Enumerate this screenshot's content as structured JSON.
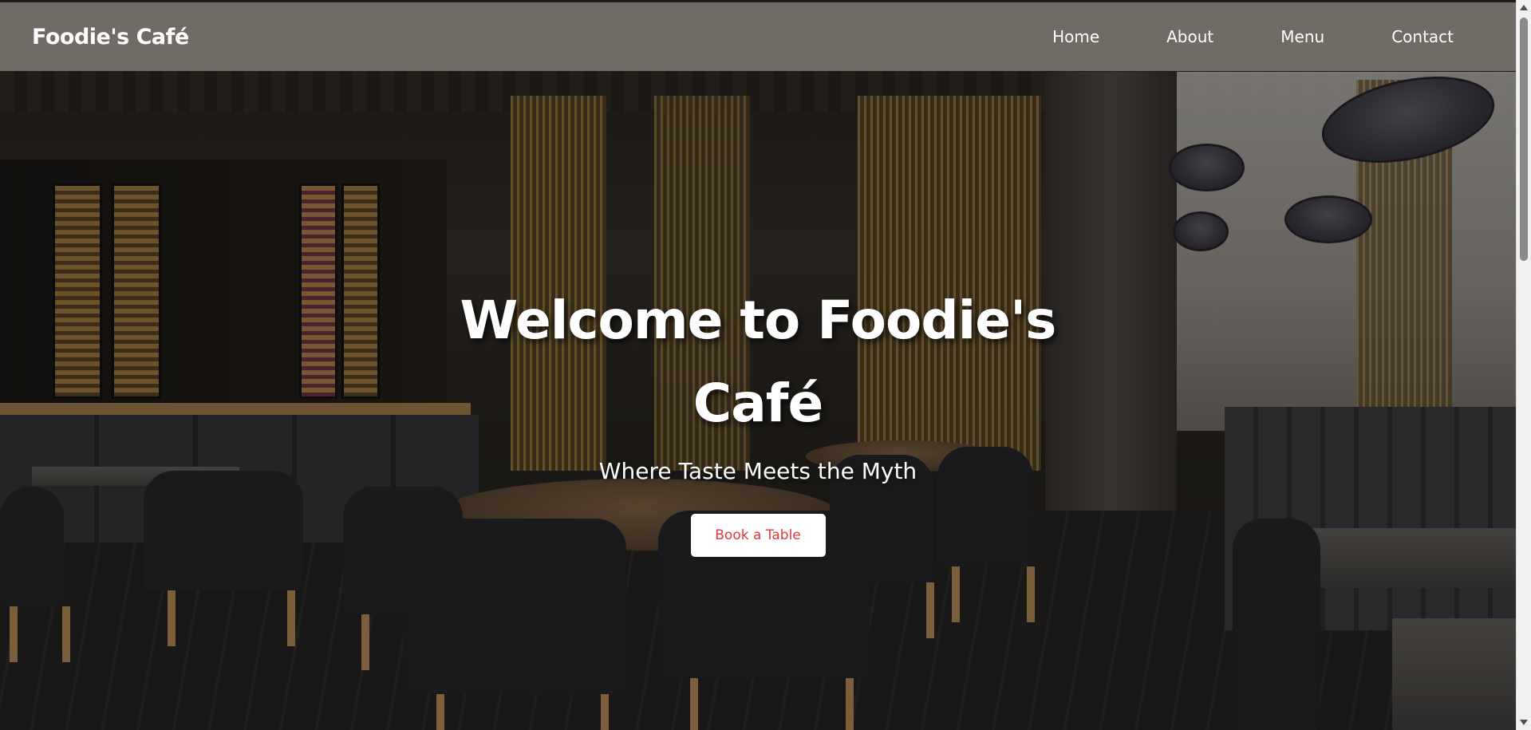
{
  "navbar": {
    "brand": "Foodie's Café",
    "links": [
      "Home",
      "About",
      "Menu",
      "Contact"
    ]
  },
  "hero": {
    "title_line1": "Welcome to Foodie's",
    "title_line2": "Café",
    "subtitle": "Where Taste Meets the Myth",
    "cta_label": "Book a Table"
  },
  "colors": {
    "navbar_bg": "#76726c",
    "cta_text": "#e0393a",
    "cta_bg": "#ffffff",
    "text": "#ffffff"
  },
  "icons": {
    "scroll_up": "scroll-up-arrow-icon",
    "scroll_down": "scroll-down-arrow-icon"
  }
}
